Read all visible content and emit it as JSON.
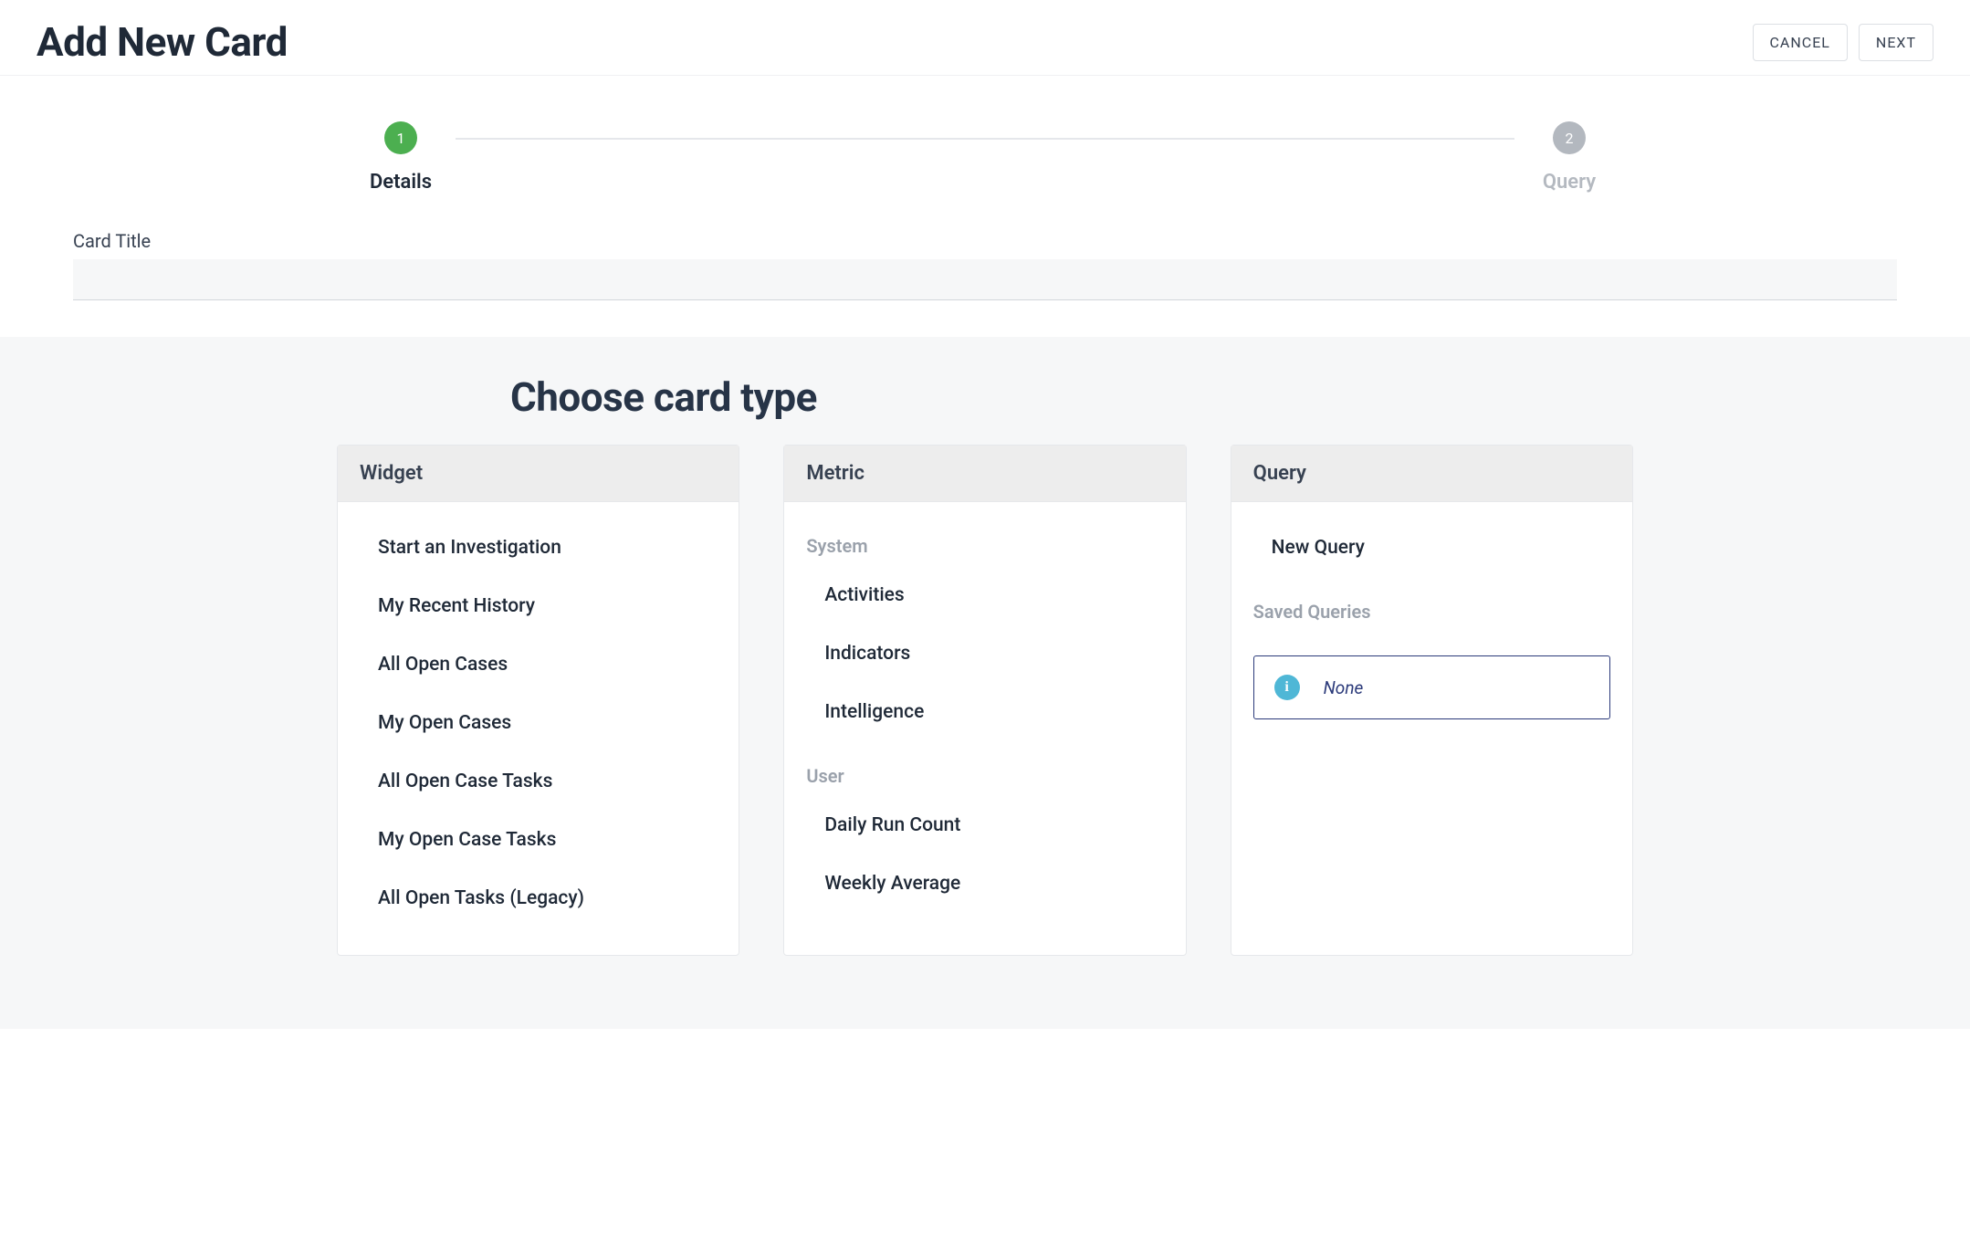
{
  "header": {
    "title": "Add New Card",
    "cancel_label": "CANCEL",
    "next_label": "NEXT"
  },
  "stepper": {
    "steps": [
      {
        "number": "1",
        "label": "Details",
        "active": true
      },
      {
        "number": "2",
        "label": "Query",
        "active": false
      }
    ]
  },
  "form": {
    "card_title_label": "Card Title",
    "card_title_value": ""
  },
  "choose": {
    "heading": "Choose card type",
    "widget": {
      "title": "Widget",
      "items": [
        "Start an Investigation",
        "My Recent History",
        "All Open Cases",
        "My Open Cases",
        "All Open Case Tasks",
        "My Open Case Tasks",
        "All Open Tasks (Legacy)"
      ]
    },
    "metric": {
      "title": "Metric",
      "system_label": "System",
      "system_items": [
        "Activities",
        "Indicators",
        "Intelligence"
      ],
      "user_label": "User",
      "user_items": [
        "Daily Run Count",
        "Weekly Average"
      ]
    },
    "query": {
      "title": "Query",
      "new_query": "New Query",
      "saved_label": "Saved Queries",
      "none_label": "None"
    }
  }
}
